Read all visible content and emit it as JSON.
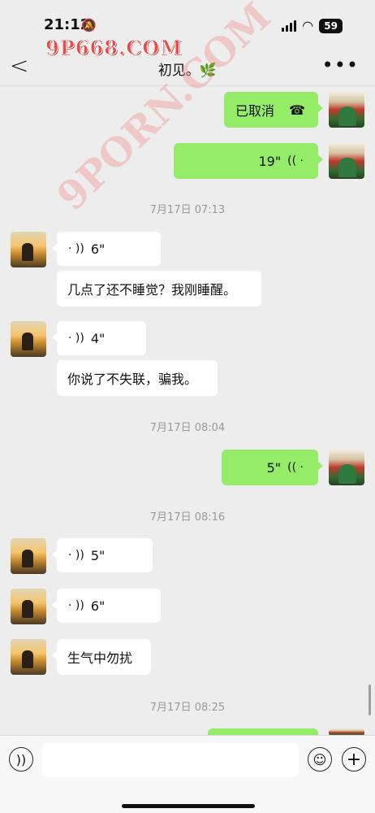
{
  "status_bar": {
    "time": "21:12",
    "battery": "59"
  },
  "watermark": {
    "top": "9P668.COM",
    "diagonal": "9PORN.COM"
  },
  "header": {
    "title": "初见。🌿"
  },
  "messages": [
    {
      "side": "out",
      "type": "call",
      "text": "已取消"
    },
    {
      "side": "out",
      "type": "voice",
      "duration": "19\""
    },
    {
      "type": "timestamp",
      "text": "7月17日 07:13"
    },
    {
      "side": "in",
      "type": "voice",
      "duration": "6\""
    },
    {
      "side": "in",
      "type": "text",
      "text": "几点了还不睡觉？我刚睡醒。"
    },
    {
      "side": "in",
      "type": "voice",
      "duration": "4\""
    },
    {
      "side": "in",
      "type": "text",
      "text": "你说了不失联，骗我。"
    },
    {
      "type": "timestamp",
      "text": "7月17日 08:04"
    },
    {
      "side": "out",
      "type": "voice",
      "duration": "5\""
    },
    {
      "type": "timestamp",
      "text": "7月17日 08:16"
    },
    {
      "side": "in",
      "type": "voice",
      "duration": "5\""
    },
    {
      "side": "in",
      "type": "voice",
      "duration": "6\""
    },
    {
      "side": "in",
      "type": "text",
      "text": "生气中勿扰"
    },
    {
      "type": "timestamp",
      "text": "7月17日 08:25"
    }
  ],
  "input_bar": {
    "message_value": ""
  },
  "icons": {
    "back": "chevron-left-icon",
    "more": "ellipsis-icon",
    "call": "phone-hangup-icon",
    "voice": "voice-wave-icon",
    "voice_toggle": "voice-input-icon",
    "emoji": "smiley-icon",
    "plus": "plus-icon"
  },
  "colors": {
    "outgoing_bubble": "#95ec69",
    "incoming_bubble": "#ffffff",
    "background": "#ededed"
  }
}
